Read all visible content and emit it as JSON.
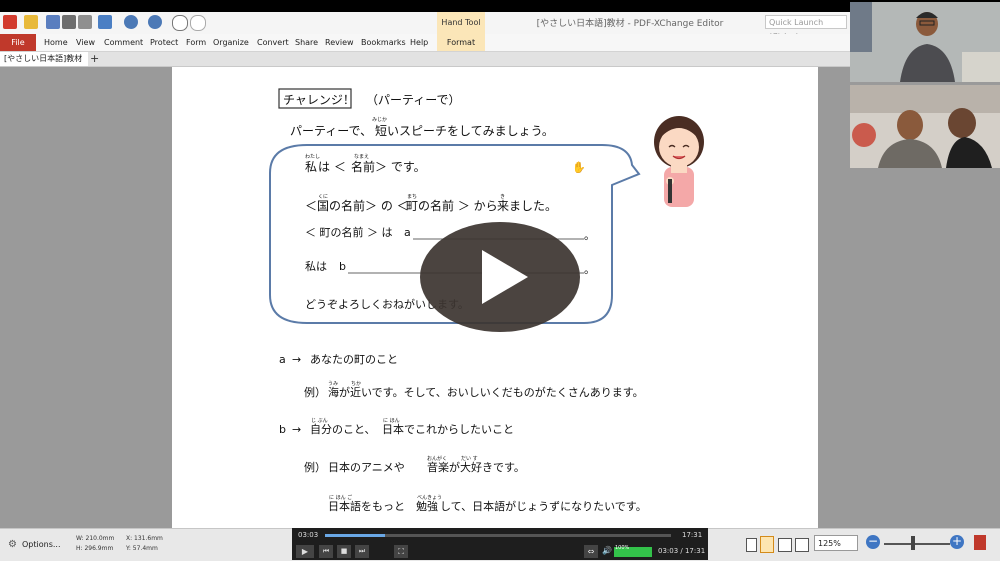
{
  "app": {
    "quick_launch_placeholder": "Quick Launch (Ctrl+.)",
    "window_title": "[やさしい日本語]教材 - PDF-XChange Editor",
    "hand_tool_label": "Hand Tool"
  },
  "ribbon": {
    "file_label": "File",
    "format_label": "Format",
    "tabs": [
      "Home",
      "View",
      "Comment",
      "Protect",
      "Form",
      "Organize",
      "Convert",
      "Share",
      "Review",
      "Bookmarks",
      "Help"
    ]
  },
  "doc_tab": {
    "name": "[やさしい日本語]教材"
  },
  "page": {
    "heading": {
      "box": "チャレンジ！",
      "rest": "（パーティーで）"
    },
    "intro": {
      "a": "パーティーで、",
      "short_kanji": "短",
      "short_ruby": "みじか",
      "b": "いスピーチをしてみましょう。"
    },
    "bubble": {
      "l1": {
        "a_kanji": "私",
        "a_ruby": "わたし",
        "b": "は ＜ ",
        "c_kanji": "名前",
        "c_ruby": "なまえ",
        "d": " ＞ です。"
      },
      "l2": {
        "a": "＜ ",
        "b_kanji": "国",
        "b_ruby": "くに",
        "c": "の名前＞ の ＜ ",
        "d_kanji": "町",
        "d_ruby": "まち",
        "e": "の名前 ＞ から",
        "f_kanji": "来",
        "f_ruby": "き",
        "g": "ました。"
      },
      "l3": {
        "text": "＜ 町の名前 ＞ は",
        "letter": "a",
        "end": "。"
      },
      "l4": {
        "text": "私は",
        "letter": "b",
        "end": "。"
      },
      "l5": "どうぞよろしくおねがいします。"
    },
    "a_label": {
      "letter": "a",
      "arrow": "→",
      "text": "あなたの町のこと"
    },
    "ex1": {
      "prefix": "例）",
      "sea": "海",
      "sea_ruby": "うみ",
      "m1": "が",
      "near": "近",
      "near_ruby": "ちか",
      "rest": "いです。そして、おいしいくだものがたくさんあります。"
    },
    "b_label": {
      "letter": "b",
      "arrow": "→",
      "jibun": "自分",
      "jibun_ruby": "じ ぶん",
      "m1": "のこと、",
      "nihon": "日本",
      "nihon_ruby": "に ほん",
      "rest": "でこれからしたいこと"
    },
    "ex2": {
      "prefix": "例）",
      "a": "日本のアニメや",
      "ongaku": "音楽",
      "ongaku_ruby": "おんがく",
      "m1": "が",
      "daisuki": "大",
      "daisuki_ruby": "だい す",
      "rest": "好きです。"
    },
    "ex3": {
      "nihongo": "日本語",
      "nihongo_ruby": "に ほん ご",
      "m1": "をもっと",
      "benkyo": "勉強",
      "benkyo_ruby": "べんきょう",
      "rest": "して、日本語がじょうずになりたいです。"
    }
  },
  "status": {
    "options_label": "Options...",
    "width_text": "W: 210.0mm",
    "height_text": "H: 296.9mm",
    "x_text": "X: 131.6mm",
    "y_text": "Y: 57.4mm",
    "zoom_value": "125%"
  },
  "player": {
    "elapsed": "03:03",
    "duration": "17:31",
    "time_display": "03:03 / 17:31",
    "progress": 0.174,
    "volume_label": "100%",
    "volume": 1.0
  },
  "colors": {
    "file_tab": "#c0392b",
    "hand_tool_bg": "#fbe6b8",
    "bubble_stroke": "#5b7ba8",
    "play_overlay": "#3c3430"
  }
}
